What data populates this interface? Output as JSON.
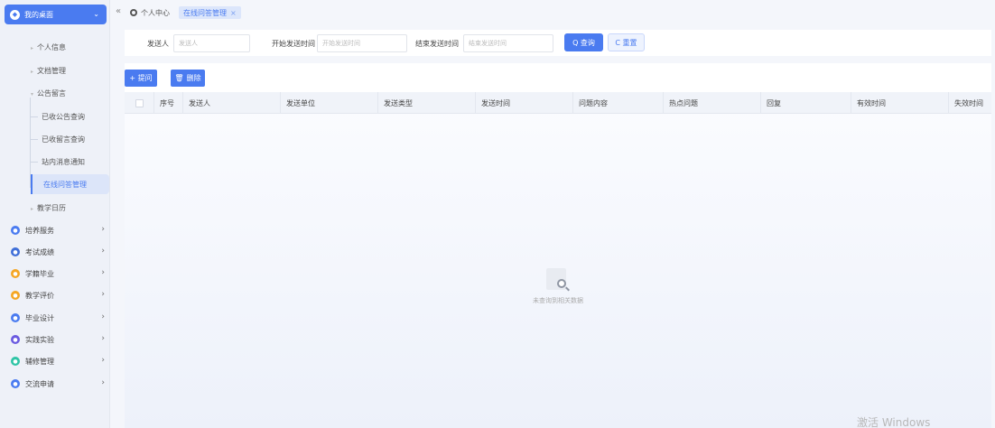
{
  "sidebar": {
    "top_label": "我的桌面",
    "sub_items": [
      "个人信息",
      "文档管理",
      "公告留言"
    ],
    "leaves": [
      "已收公告查询",
      "已收留言查询",
      "站内消息通知",
      "在线问答管理"
    ],
    "after": "教学日历",
    "groups": [
      {
        "label": "培养服务",
        "color": "#4a7bf0"
      },
      {
        "label": "考试成绩",
        "color": "#3f6fd8"
      },
      {
        "label": "学籍毕业",
        "color": "#f5a623"
      },
      {
        "label": "教学评价",
        "color": "#f5a623"
      },
      {
        "label": "毕业设计",
        "color": "#4a7bf0"
      },
      {
        "label": "实践实验",
        "color": "#6a5ae0"
      },
      {
        "label": "辅修管理",
        "color": "#2ec4a6"
      },
      {
        "label": "交流申请",
        "color": "#4a7bf0"
      }
    ]
  },
  "tabs": {
    "collapse": "«",
    "home": "个人中心",
    "active": "在线问答管理",
    "close": "×"
  },
  "search": {
    "sender_label": "发送人",
    "sender_placeholder": "发送人",
    "start_label": "开始发送时间",
    "start_placeholder": "开始发送时间",
    "end_label": "结束发送时间",
    "end_placeholder": "结束发送时间",
    "query": "Q 查询",
    "reset": "C 重置"
  },
  "actions": {
    "add": "+ 提问",
    "delete": "删除"
  },
  "table": {
    "columns": [
      "序号",
      "发送人",
      "发送单位",
      "发送类型",
      "发送时间",
      "问题内容",
      "热点问题",
      "回复",
      "有效时间",
      "失效时间"
    ],
    "empty": "未查询到相关数据"
  },
  "watermark": "激活 Windows"
}
